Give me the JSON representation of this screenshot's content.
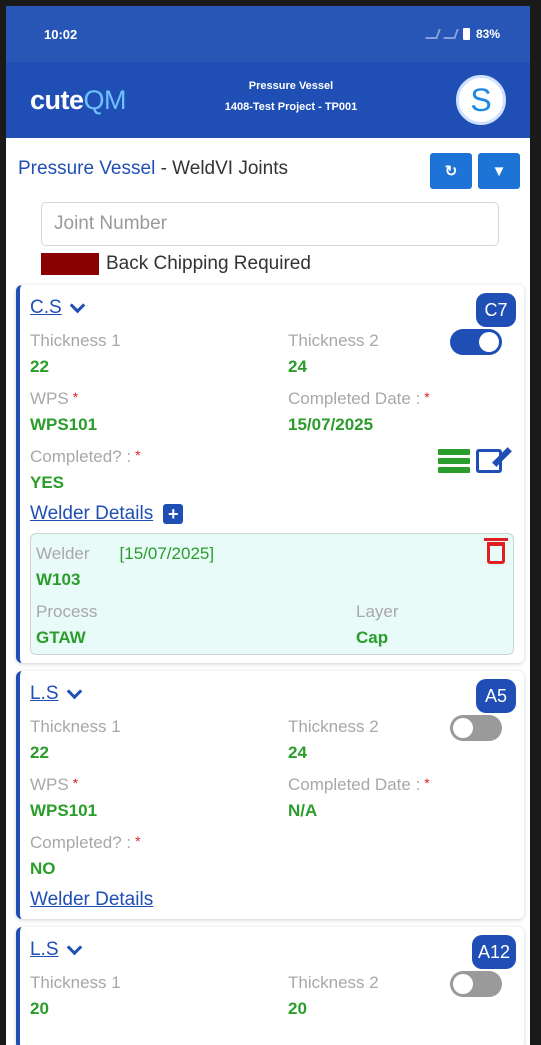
{
  "status": {
    "time": "10:02",
    "battery": "83%"
  },
  "app": {
    "logo_main": "cute",
    "logo_accent": "QM",
    "header_line1": "Pressure Vessel",
    "header_line2": "1408-Test Project - TP001",
    "avatar_letter": "S"
  },
  "page": {
    "title_project": "Pressure Vessel",
    "title_rest": " - WeldVI Joints",
    "search_placeholder": "Joint Number",
    "legend_label": "Back Chipping Required",
    "legend_color": "#8b0000"
  },
  "labels": {
    "thickness1": "Thickness 1",
    "thickness2": "Thickness 2",
    "wps": "WPS",
    "completed_date": "Completed Date :",
    "completed": "Completed? :",
    "welder_details": "Welder Details",
    "required_mark": "*",
    "welder": "Welder",
    "process": "Process",
    "layer": "Layer"
  },
  "joints": [
    {
      "type": "C.S",
      "badge": "C7",
      "thickness1": "22",
      "thickness2": "24",
      "toggle_on": true,
      "wps": "WPS101",
      "completed_date": "15/07/2025",
      "completed": "YES",
      "welder": {
        "id": "W103",
        "date": "[15/07/2025]",
        "process": "GTAW",
        "layer": "Cap"
      }
    },
    {
      "type": "L.S",
      "badge": "A5",
      "thickness1": "22",
      "thickness2": "24",
      "toggle_on": false,
      "wps": "WPS101",
      "completed_date": "N/A",
      "completed": "NO"
    },
    {
      "type": "L.S",
      "badge": "A12",
      "thickness1": "20",
      "thickness2": "20",
      "toggle_on": false
    }
  ],
  "colors": {
    "primary": "#1f4fb4",
    "value_green": "#2a9d2a",
    "required_red": "#e02020",
    "welder_bg": "#e8fbf8"
  }
}
